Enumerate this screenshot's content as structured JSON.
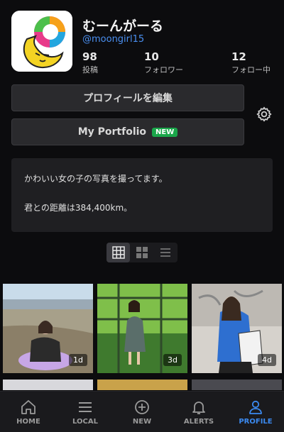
{
  "profile": {
    "display_name": "むーんがーる",
    "handle": "@moongirl15",
    "stats": [
      {
        "count": "98",
        "label": "投稿"
      },
      {
        "count": "10",
        "label": "フォロワー"
      },
      {
        "count": "12",
        "label": "フォロー中"
      }
    ]
  },
  "buttons": {
    "edit_profile": "プロフィールを編集",
    "portfolio": "My Portfolio",
    "portfolio_badge": "NEW"
  },
  "bio": {
    "line1": "かわいい女の子の写真を撮ってます。",
    "line2": "君との距離は384,400km。"
  },
  "view_modes": [
    "grid-large",
    "grid-small",
    "list"
  ],
  "posts": [
    {
      "age": "1d"
    },
    {
      "age": "3d"
    },
    {
      "age": "4d"
    }
  ],
  "nav": {
    "home": "HOME",
    "local": "LOCAL",
    "new": "NEW",
    "alerts": "ALERTS",
    "profile": "PROFILE"
  },
  "colors": {
    "accent": "#3b8af0",
    "badge": "#1aa64a",
    "background": "#0c0c0e"
  }
}
